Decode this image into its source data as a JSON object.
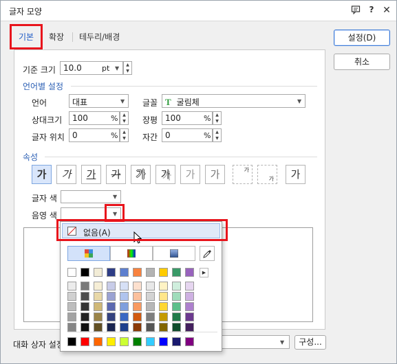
{
  "window": {
    "title": "글자 모양",
    "icons": [
      "message-icon",
      "help-icon",
      "close-icon"
    ]
  },
  "tabs": [
    {
      "label": "기본"
    },
    {
      "label": "확장"
    },
    {
      "label": "테두리/배경"
    }
  ],
  "base": {
    "label": "기준 크기",
    "value": "10.0",
    "unit": "pt"
  },
  "lang_section": "언어별 설정",
  "lang": {
    "label": "언어",
    "value": "대표"
  },
  "font": {
    "label": "글꼴",
    "value": "굴림체",
    "icon_text": "T"
  },
  "rel_size": {
    "label": "상대크기",
    "value": "100",
    "unit": "%"
  },
  "width": {
    "label": "장평",
    "value": "100",
    "unit": "%"
  },
  "pos": {
    "label": "글자 위치",
    "value": "0",
    "unit": "%"
  },
  "spacing": {
    "label": "자간",
    "value": "0",
    "unit": "%"
  },
  "attr_section": "속성",
  "attr_buttons": [
    "가",
    "가",
    "가",
    "가",
    "가",
    "가",
    "가",
    "가",
    "가",
    "가",
    "가"
  ],
  "text_color_label": "글자 색",
  "shade_color_label": "음영 색",
  "buttons": {
    "ok": "설정(D)",
    "cancel": "취소",
    "compose": "구성..."
  },
  "bottom_label": "대화 상자 설정",
  "popup": {
    "none_label": "없음(A)",
    "row1": [
      "#ffffff",
      "#000000",
      "#f2ecd6",
      "#2e3d86",
      "#5d7fcf",
      "#f8823e",
      "#b3b3b3",
      "#ffcc00",
      "#3a9a68",
      "#9863bd"
    ],
    "shades": [
      [
        "#ececec",
        "#d0d0d0",
        "#bdbdbd",
        "#a3a3a3",
        "#858585"
      ],
      [
        "#7a7a7a",
        "#4d4d4d",
        "#353535",
        "#222222",
        "#101010"
      ],
      [
        "#f6eed6",
        "#e8d8a8",
        "#cfb878",
        "#9a8449",
        "#625024"
      ],
      [
        "#c8cce8",
        "#9aa2d2",
        "#5c69b0",
        "#34427f",
        "#1a2550"
      ],
      [
        "#d6e0f6",
        "#b0c4ee",
        "#7f9fdd",
        "#3b68c3",
        "#1e3f8c"
      ],
      [
        "#fde0ce",
        "#fbc09d",
        "#f89a62",
        "#d15b12",
        "#8a3a08"
      ],
      [
        "#e8e8e8",
        "#d3d3d3",
        "#b7b7b7",
        "#7e7e7e",
        "#555555"
      ],
      [
        "#fff3c4",
        "#ffe68a",
        "#ffd733",
        "#c49a00",
        "#826600"
      ],
      [
        "#cfeedd",
        "#a0dcbb",
        "#5ebf8b",
        "#217a4a",
        "#104d2d"
      ],
      [
        "#e6d6f0",
        "#ceb1e2",
        "#ad80cd",
        "#6c3a8f",
        "#44205e"
      ]
    ],
    "bottom_row": [
      "#000000",
      "#ff0000",
      "#ff6600",
      "#ffee00",
      "#ccff33",
      "#008000",
      "#33ccff",
      "#0000ff",
      "#1a1a6e",
      "#800080"
    ]
  }
}
